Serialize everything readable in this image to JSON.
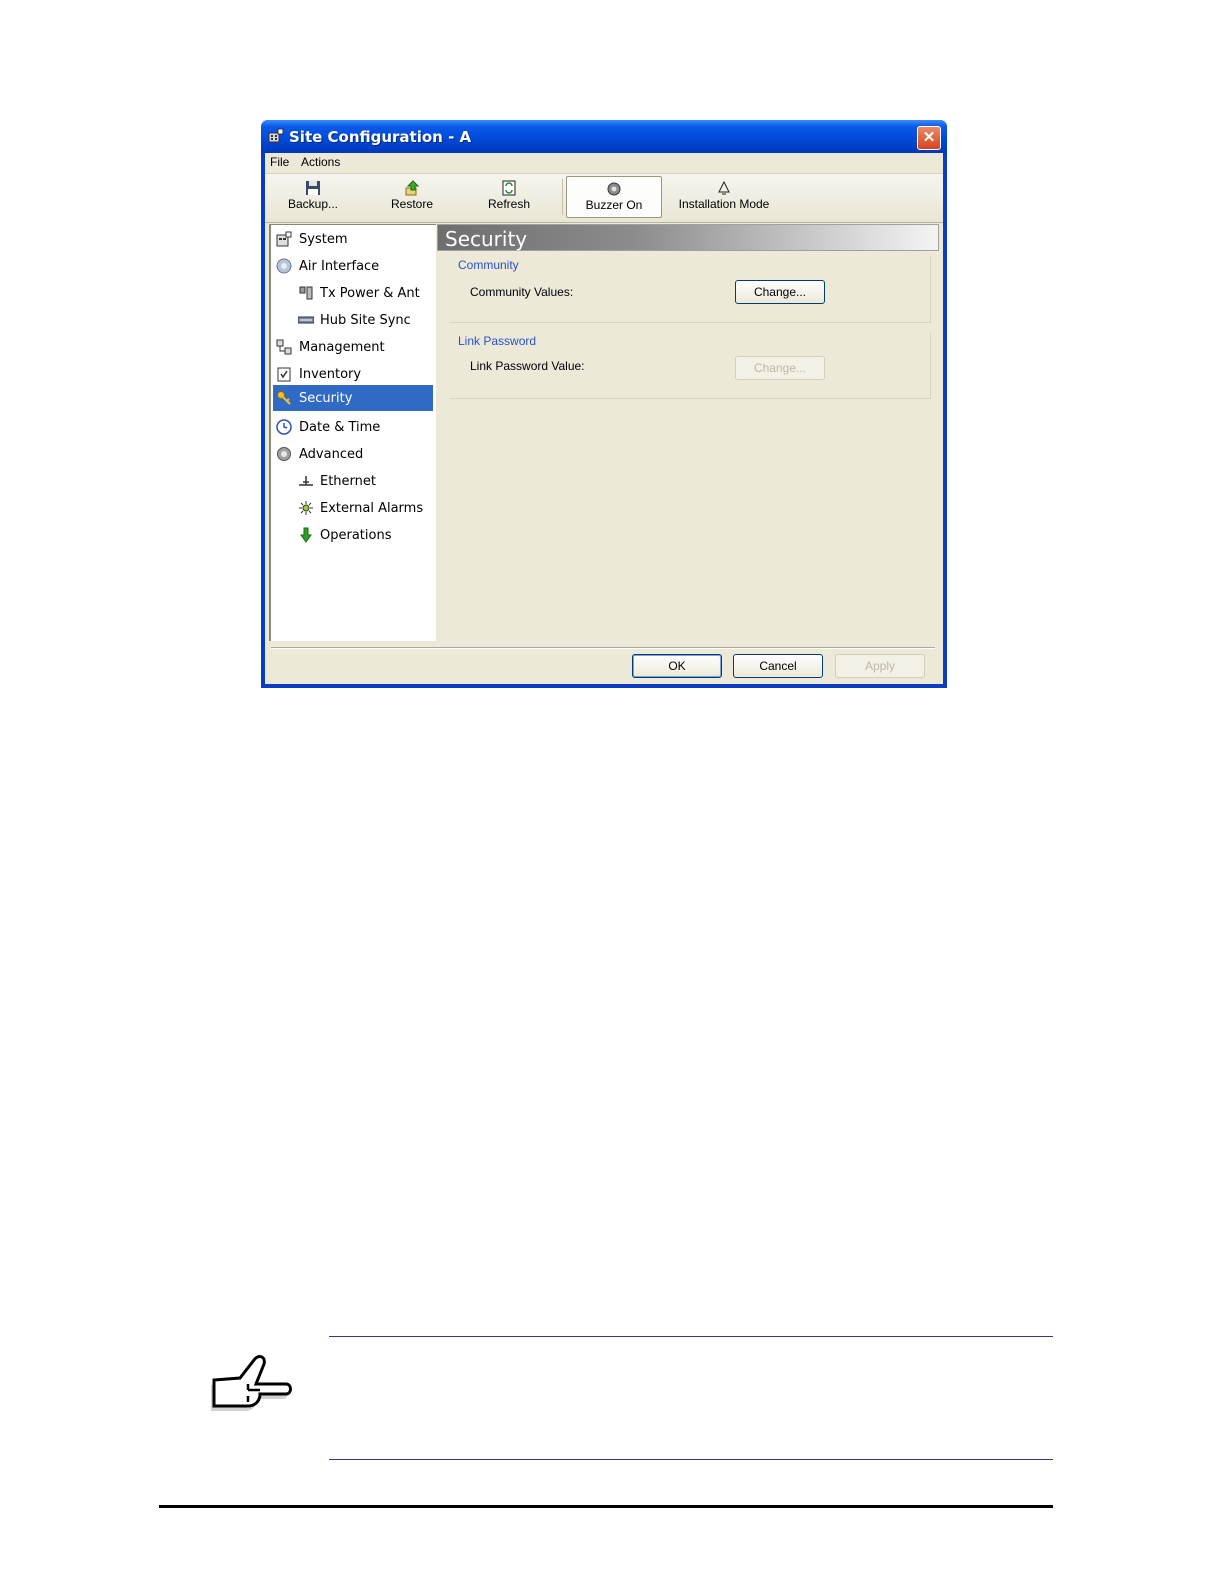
{
  "window": {
    "title": "Site Configuration - A",
    "close_glyph": "✕"
  },
  "menu": {
    "items": [
      "File",
      "Actions"
    ]
  },
  "toolbar": {
    "buttons": [
      {
        "label": "Backup...",
        "icon": "floppy-disk-icon"
      },
      {
        "label": "Restore",
        "icon": "restore-arrow-icon"
      },
      {
        "label": "Refresh",
        "icon": "refresh-icon"
      },
      {
        "label": "Buzzer On",
        "icon": "buzzer-icon",
        "pressed": true
      },
      {
        "label": "Installation Mode",
        "icon": "installation-mode-icon"
      }
    ]
  },
  "nav": {
    "items": [
      {
        "label": "System",
        "icon": "system-icon",
        "level": 0
      },
      {
        "label": "Air Interface",
        "icon": "globe-icon",
        "level": 0
      },
      {
        "label": "Tx Power & Ant",
        "icon": "antenna-icon",
        "level": 1
      },
      {
        "label": "Hub Site Sync",
        "icon": "sync-icon",
        "level": 1
      },
      {
        "label": "Management",
        "icon": "management-icon",
        "level": 0
      },
      {
        "label": "Inventory",
        "icon": "clipboard-icon",
        "level": 0
      },
      {
        "label": "Security",
        "icon": "keys-icon",
        "level": 0,
        "selected": true
      },
      {
        "label": "Date & Time",
        "icon": "clock-icon",
        "level": 0
      },
      {
        "label": "Advanced",
        "icon": "gear-icon",
        "level": 0
      },
      {
        "label": "Ethernet",
        "icon": "ethernet-icon",
        "level": 1
      },
      {
        "label": "External Alarms",
        "icon": "alarm-icon",
        "level": 1
      },
      {
        "label": "Operations",
        "icon": "down-arrow-icon",
        "level": 1
      }
    ]
  },
  "content": {
    "header": "Security",
    "community": {
      "title": "Community",
      "label": "Community Values:",
      "button": "Change..."
    },
    "link_password": {
      "title": "Link Password",
      "label": "Link Password Value:",
      "button": "Change...",
      "button_disabled": true
    }
  },
  "footer": {
    "ok": "OK",
    "cancel": "Cancel",
    "apply": "Apply",
    "apply_disabled": true
  },
  "colors": {
    "title_bar": "#0048d8",
    "selection": "#316ac5",
    "group_title": "#2a52be",
    "client_bg": "#ece9d8"
  },
  "note": {
    "icon": "pointing-hand-icon"
  }
}
